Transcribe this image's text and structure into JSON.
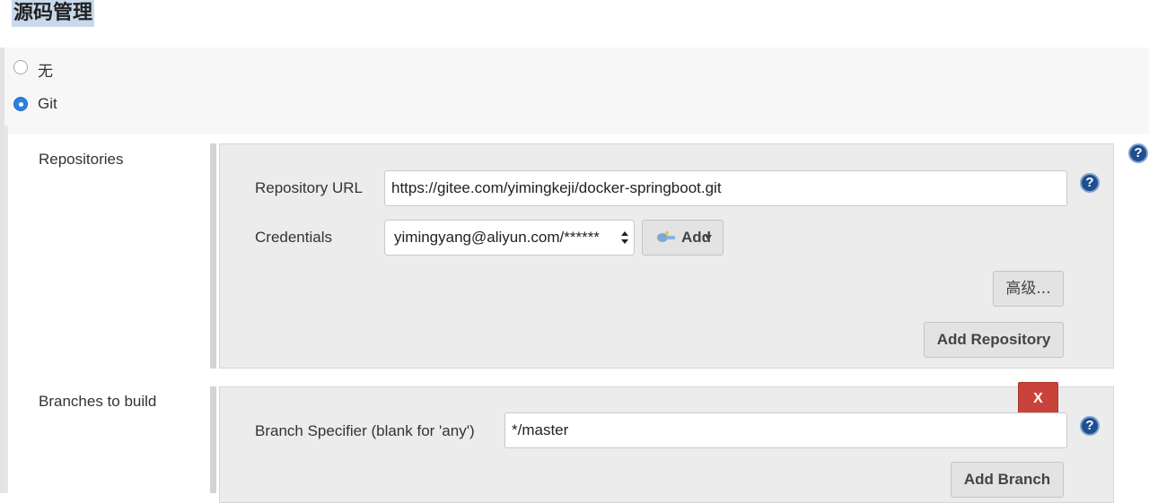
{
  "section": {
    "title": "源码管理"
  },
  "scm_options": [
    {
      "label": "无",
      "selected": false
    },
    {
      "label": "Git",
      "selected": true
    }
  ],
  "repositories": {
    "label": "Repositories",
    "url_label": "Repository URL",
    "url_value": "https://gitee.com/yimingkeji/docker-springboot.git",
    "credentials_label": "Credentials",
    "credentials_value": "yimingyang@aliyun.com/******",
    "add_credentials_label": "Add",
    "advanced_label": "高级...",
    "add_repository_label": "Add Repository"
  },
  "branches": {
    "label": "Branches to build",
    "delete_label": "X",
    "specifier_label": "Branch Specifier (blank for 'any')",
    "specifier_value": "*/master",
    "add_branch_label": "Add Branch"
  },
  "icons": {
    "help": "?",
    "key_icon": "key-icon",
    "dropdown_arrow": "caret-down-icon"
  },
  "colors": {
    "accent_blue": "#2f7fe0",
    "help_blue": "#1f4f8f",
    "delete_red": "#c9433a",
    "title_highlight": "#c9d9ec"
  }
}
